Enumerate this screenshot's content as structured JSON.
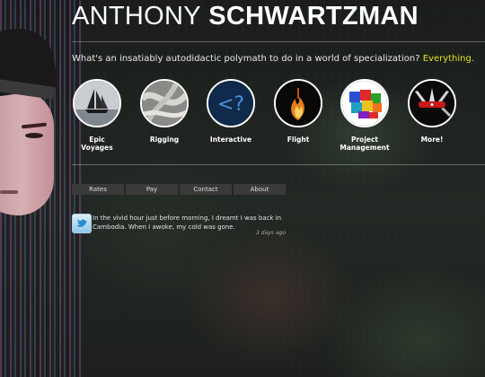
{
  "header": {
    "name_first": "ANTHONY",
    "name_last": "SCHWARTZMAN",
    "tagline": "What's an insatiably autodidactic polymath to do in a world of specialization?",
    "tagline_highlight": "Everything."
  },
  "nav": [
    {
      "label_line1": "Epic",
      "label_line2": "Voyages",
      "icon": "sailboat-icon"
    },
    {
      "label_line1": "Rigging",
      "label_line2": "",
      "icon": "rope-icon"
    },
    {
      "label_line1": "Interactive",
      "label_line2": "",
      "icon": "code-icon"
    },
    {
      "label_line1": "Flight",
      "label_line2": "",
      "icon": "fire-icon"
    },
    {
      "label_line1": "Project",
      "label_line2": "Management",
      "icon": "puzzle-icon"
    },
    {
      "label_line1": "More!",
      "label_line2": "",
      "icon": "swiss-knife-icon"
    }
  ],
  "tabs": [
    "Rates",
    "Pay",
    "Contact",
    "About"
  ],
  "tweet": {
    "icon": "twitter-bird-icon",
    "text": "In the vivid hour just before morning, I dreamt I was back in Cambodia. When I awoke, my cold was gone.",
    "time": "3 days ago"
  },
  "colors": {
    "highlight": "#e6e020",
    "tab_bg": "#3a3a3a"
  }
}
